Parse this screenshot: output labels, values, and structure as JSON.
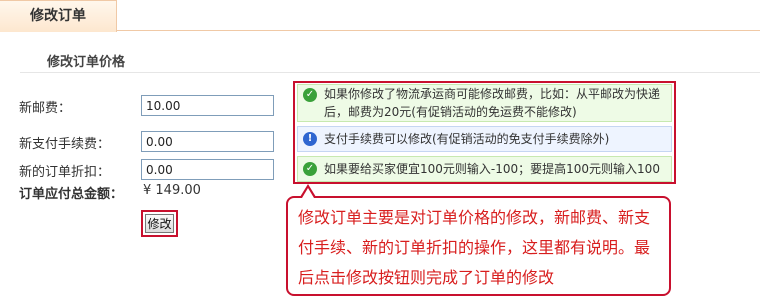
{
  "tab": {
    "label": "修改订单"
  },
  "section": {
    "title": "修改订单价格"
  },
  "form": {
    "new_postage_label": "新邮费：",
    "new_postage_value": "10.00",
    "new_fee_label": "新支付手续费：",
    "new_fee_value": "0.00",
    "new_discount_label": "新的订单折扣：",
    "new_discount_value": "0.00",
    "total_label": "订单应付总金额：",
    "total_value": "¥ 149.00",
    "submit_label": "修改"
  },
  "notes": [
    {
      "icon": "check-icon",
      "text": "如果你修改了物流承运商可能修改邮费，比如：从平邮改为快递后，邮费为20元(有促销活动的免运费不能修改)"
    },
    {
      "icon": "info-icon",
      "text": "支付手续费可以修改(有促销活动的免支付手续费除外)"
    },
    {
      "icon": "check-icon",
      "text": "如果要给买家便宜100元则输入-100；要提高100元则输入100"
    }
  ],
  "callout": {
    "text": "修改订单主要是对订单价格的修改，新邮费、新支付手续、新的订单折扣的操作，这里都有说明。最后点击修改按钮则完成了订单的修改"
  },
  "colors": {
    "highlight": "#c8102e",
    "callout_text": "#d81e1e",
    "tab_bg": "#fde7cf"
  }
}
